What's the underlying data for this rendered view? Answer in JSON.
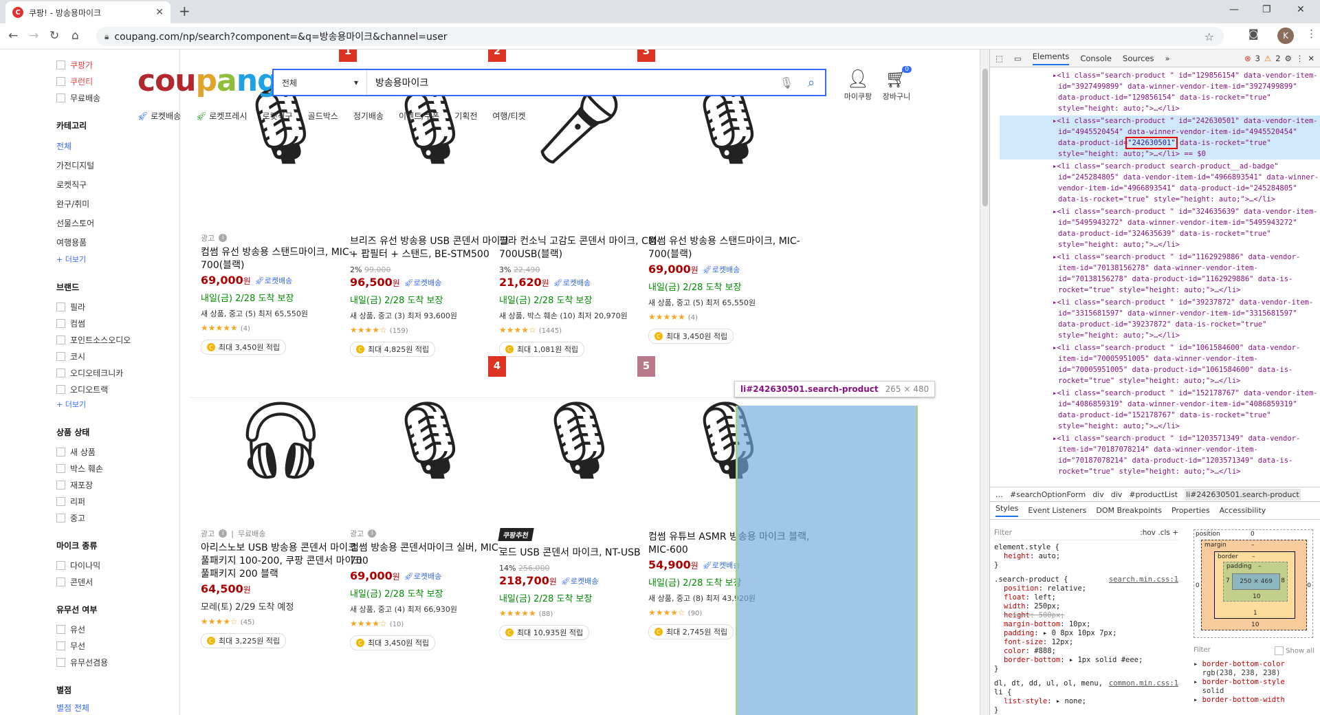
{
  "browser": {
    "tab_title": "쿠팡! - 방송용마이크",
    "favicon": "C",
    "url": "coupang.com/np/search?component=&q=방송용마이크&channel=user",
    "avatar_letter": "K"
  },
  "sidebar": {
    "top_checks": [
      "쿠팡가",
      "쿠런티",
      "무료배송"
    ],
    "category_heading": "카테고리",
    "categories": [
      "전체",
      "가전디지털",
      "로켓직구",
      "완구/취미",
      "선물스토어",
      "여행용품"
    ],
    "more": "+ 더보기",
    "brand_heading": "브랜드",
    "brands": [
      "필라",
      "컴썸",
      "포인트소스오디오",
      "코시",
      "오디오테크니카",
      "오디오트랙"
    ],
    "condition_heading": "상품 상태",
    "conditions": [
      "새 상품",
      "박스 훼손",
      "재포장",
      "리퍼",
      "중고"
    ],
    "mic_heading": "마이크 종류",
    "mic_types": [
      "다이나믹",
      "콘덴서"
    ],
    "wire_heading": "유무선 여부",
    "wire_types": [
      "유선",
      "무선",
      "유무선겸용"
    ],
    "rating_heading": "별점",
    "rating_all": "별점 전체"
  },
  "header": {
    "logo": "coupang",
    "search_category": "전체",
    "search_query": "방송용마이크",
    "my_coupang": "마이쿠팡",
    "cart": "장바구니",
    "cart_count": "0",
    "nav": [
      "로켓배송",
      "로켓프레시",
      "로켓직구",
      "골드박스",
      "정기배송",
      "이벤트/쿠폰",
      "기획전",
      "여행/티켓"
    ]
  },
  "products": [
    {
      "rank": "",
      "meta": "광고",
      "meta2": "",
      "name": "컴썸 유선 방송용 스탠드마이크, MIC-700(블랙)",
      "discount": "",
      "original": "",
      "price": "69,000",
      "won": "원",
      "rocket": "로켓배송",
      "arrive": "내일(금) 2/28 도착 보장",
      "seller": "새 상품, 중고 (5) 최저 65,550원",
      "stars": "★★★★★",
      "reviews": "(4)",
      "reward": "최대 3,450원 적립",
      "pick": ""
    },
    {
      "rank": "1",
      "meta": "",
      "meta2": "",
      "name": "브리즈 유선 방송용 USB 콘덴서 마이크 + 팝필터 + 스탠드, BE-STM500",
      "discount": "2%",
      "original": "99,000",
      "price": "96,500",
      "won": "원",
      "rocket": "로켓배송",
      "arrive": "내일(금) 2/28 도착 보장",
      "seller": "새 상품, 중고 (3) 최저 93,600원",
      "stars": "★★★★☆",
      "reviews": "(159)",
      "reward": "최대 4,825원 적립",
      "pick": ""
    },
    {
      "rank": "2",
      "meta": "",
      "meta2": "",
      "name": "필라 컨소닉 고감도 콘덴서 마이크, CM-700USB(블랙)",
      "discount": "3%",
      "original": "22,490",
      "price": "21,620",
      "won": "원",
      "rocket": "로켓배송",
      "arrive": "내일(금) 2/28 도착 보장",
      "seller": "새 상품, 박스 훼손 (10) 최저 20,970원",
      "stars": "★★★★☆",
      "reviews": "(1445)",
      "reward": "최대 1,081원 적립",
      "pick": ""
    },
    {
      "rank": "3",
      "meta": "",
      "meta2": "",
      "name": "컴썸 유선 방송용 스탠드마이크, MIC-700(블랙)",
      "discount": "",
      "original": "",
      "price": "69,000",
      "won": "원",
      "rocket": "로켓배송",
      "arrive": "내일(금) 2/28 도착 보장",
      "seller": "새 상품, 중고 (5) 최저 65,550원",
      "stars": "★★★★★",
      "reviews": "(4)",
      "reward": "최대 3,450원 적립",
      "pick": ""
    },
    {
      "rank": "",
      "meta": "광고",
      "meta2": "무료배송",
      "name": "아리스노보 USB 방송용 콘덴서 마이크 풀패키지 100-200, 쿠팡 콘덴서 마이크 풀패키지 200 블랙",
      "discount": "",
      "original": "",
      "price": "64,500",
      "won": "원",
      "rocket": "",
      "arrive": "모레(토) 2/29 도착 예정",
      "seller": "",
      "stars": "★★★★☆",
      "reviews": "(45)",
      "reward": "최대 3,225원 적립",
      "pick": ""
    },
    {
      "rank": "",
      "meta": "광고",
      "meta2": "",
      "name": "컴썸 방송용 콘덴서마이크 실버, MIC-700",
      "discount": "",
      "original": "",
      "price": "69,000",
      "won": "원",
      "rocket": "로켓배송",
      "arrive": "내일(금) 2/28 도착 보장",
      "seller": "새 상품, 중고 (4) 최저 66,930원",
      "stars": "★★★★☆",
      "reviews": "(10)",
      "reward": "최대 3,450원 적립",
      "pick": ""
    },
    {
      "rank": "4",
      "meta": "",
      "meta2": "",
      "name": "로드 USB 콘덴서 마이크, NT-USB",
      "discount": "14%",
      "original": "256,000",
      "price": "218,700",
      "won": "원",
      "rocket": "로켓배송",
      "arrive": "내일(금) 2/28 도착 보장",
      "seller": "",
      "stars": "★★★★★",
      "reviews": "(88)",
      "reward": "최대 10,935원 적립",
      "pick": "쿠팡추천"
    },
    {
      "rank": "5",
      "meta": "",
      "meta2": "",
      "name": "컴썸 유튜브 ASMR 방송용 마이크 블랙, MIC-600",
      "discount": "",
      "original": "",
      "price": "54,900",
      "won": "원",
      "rocket": "로켓배송",
      "arrive": "내일(금) 2/28 도착 보장",
      "seller": "새 상품, 중고 (8) 최저 43,920원",
      "stars": "★★★★☆",
      "reviews": "(90)",
      "reward": "최대 2,745원 적립",
      "pick": ""
    }
  ],
  "inspect_tooltip": {
    "selector": "li#242630501.search-product",
    "size": "265 × 480"
  },
  "devtools": {
    "tabs": [
      "Elements",
      "Console",
      "Sources",
      "»"
    ],
    "errors": "3",
    "warnings": "2",
    "dom_lines": [
      "▸<li class=\"search-product \" id=\"129856154\" data-vendor-item-id=\"3927499899\" data-winner-vendor-item-id=\"3927499899\" data-product-id=\"129856154\" data-is-rocket=\"true\" style=\"height: auto;\">…</li>",
      "▸<li class=\"search-product \" id=\"242630501\" data-vendor-item-id=\"4945520454\" data-winner-vendor-item-id=\"4945520454\" data-product-id=\"242630501\" data-is-rocket=\"true\" style=\"height: auto;\">…</li> == $0",
      "▸<li class=\"search-product search-product__ad-badge\" id=\"245284805\" data-vendor-item-id=\"4966893541\" data-winner-vendor-item-id=\"4966893541\" data-product-id=\"245284805\" data-is-rocket=\"true\" style=\"height: auto;\">…</li>",
      "▸<li class=\"search-product \" id=\"324635639\" data-vendor-item-id=\"5495943272\" data-winner-vendor-item-id=\"5495943272\" data-product-id=\"324635639\" data-is-rocket=\"true\" style=\"height: auto;\">…</li>",
      "▸<li class=\"search-product \" id=\"1162929886\" data-vendor-item-id=\"70138156278\" data-winner-vendor-item-id=\"70138156278\" data-product-id=\"1162929886\" data-is-rocket=\"true\" style=\"height: auto;\">…</li>",
      "▸<li class=\"search-product \" id=\"39237872\" data-vendor-item-id=\"3315681597\" data-winner-vendor-item-id=\"3315681597\" data-product-id=\"39237872\" data-is-rocket=\"true\" style=\"height: auto;\">…</li>",
      "▸<li class=\"search-product \" id=\"1061584600\" data-vendor-item-id=\"70005951005\" data-winner-vendor-item-id=\"70005951005\" data-product-id=\"1061584600\" data-is-rocket=\"true\" style=\"height: auto;\">…</li>",
      "▸<li class=\"search-product \" id=\"152178767\" data-vendor-item-id=\"4086859319\" data-winner-vendor-item-id=\"4086859319\" data-product-id=\"152178767\" data-is-rocket=\"true\" style=\"height: auto;\">…</li>",
      "▸<li class=\"search-product \" id=\"1203571349\" data-vendor-item-id=\"70187078214\" data-winner-vendor-item-id=\"70187078214\" data-product-id=\"1203571349\" data-is-rocket=\"true\" style=\"height: auto;\">…</li>"
    ],
    "selected_line": 1,
    "boxed_value": "\"242630501\"",
    "breadcrumbs": [
      "…",
      "#searchOptionForm",
      "div",
      "div",
      "#productList",
      "li#242630501.search-product"
    ],
    "style_tabs": [
      "Styles",
      "Event Listeners",
      "DOM Breakpoints",
      "Properties",
      "Accessibility"
    ],
    "filter": "Filter",
    "hov": ":hov .cls +",
    "rules": [
      {
        "selector": "element.style {",
        "src": "",
        "props": [
          {
            "k": "height",
            "v": "auto;",
            "strike": false
          }
        ]
      },
      {
        "selector": ".search-product {",
        "src": "search.min.css:1",
        "props": [
          {
            "k": "position",
            "v": "relative;",
            "strike": false
          },
          {
            "k": "float",
            "v": "left;",
            "strike": false
          },
          {
            "k": "width",
            "v": "250px;",
            "strike": false
          },
          {
            "k": "height",
            "v": "500px;",
            "strike": true
          },
          {
            "k": "margin-bottom",
            "v": "10px;",
            "strike": false
          },
          {
            "k": "padding",
            "v": "▸ 0 8px 10px 7px;",
            "strike": false
          },
          {
            "k": "font-size",
            "v": "12px;",
            "strike": false
          },
          {
            "k": "color",
            "v": "#888;",
            "strike": false
          },
          {
            "k": "border-bottom",
            "v": "▸ 1px solid #eee;",
            "strike": false
          }
        ]
      },
      {
        "selector": "dl, dt, dd, ul, ol, menu, li {",
        "src": "common.min.css:1",
        "props": [
          {
            "k": "list-style",
            "v": "▸ none;",
            "strike": false
          }
        ]
      }
    ],
    "box": {
      "position": "position",
      "pos_val": "0",
      "margin": "margin",
      "margin_val": "–",
      "border": "border",
      "border_val": "–",
      "padding": "padding",
      "padding_val": "–",
      "content": "250 × 469",
      "left_pad": "7",
      "right_pad": "8",
      "bottom_pad": "10",
      "bottom_margin": "10",
      "bottom_border": "1",
      "outer_left": "0",
      "outer_right": "0",
      "outer_bottom": "–"
    },
    "computed_filter": "Filter",
    "show_all": "Show all",
    "computed": [
      {
        "k": "border-bottom-color",
        "v": "rgb(238, 238, 238)"
      },
      {
        "k": "border-bottom-style",
        "v": "solid"
      },
      {
        "k": "border-bottom-width",
        "v": ""
      }
    ]
  }
}
